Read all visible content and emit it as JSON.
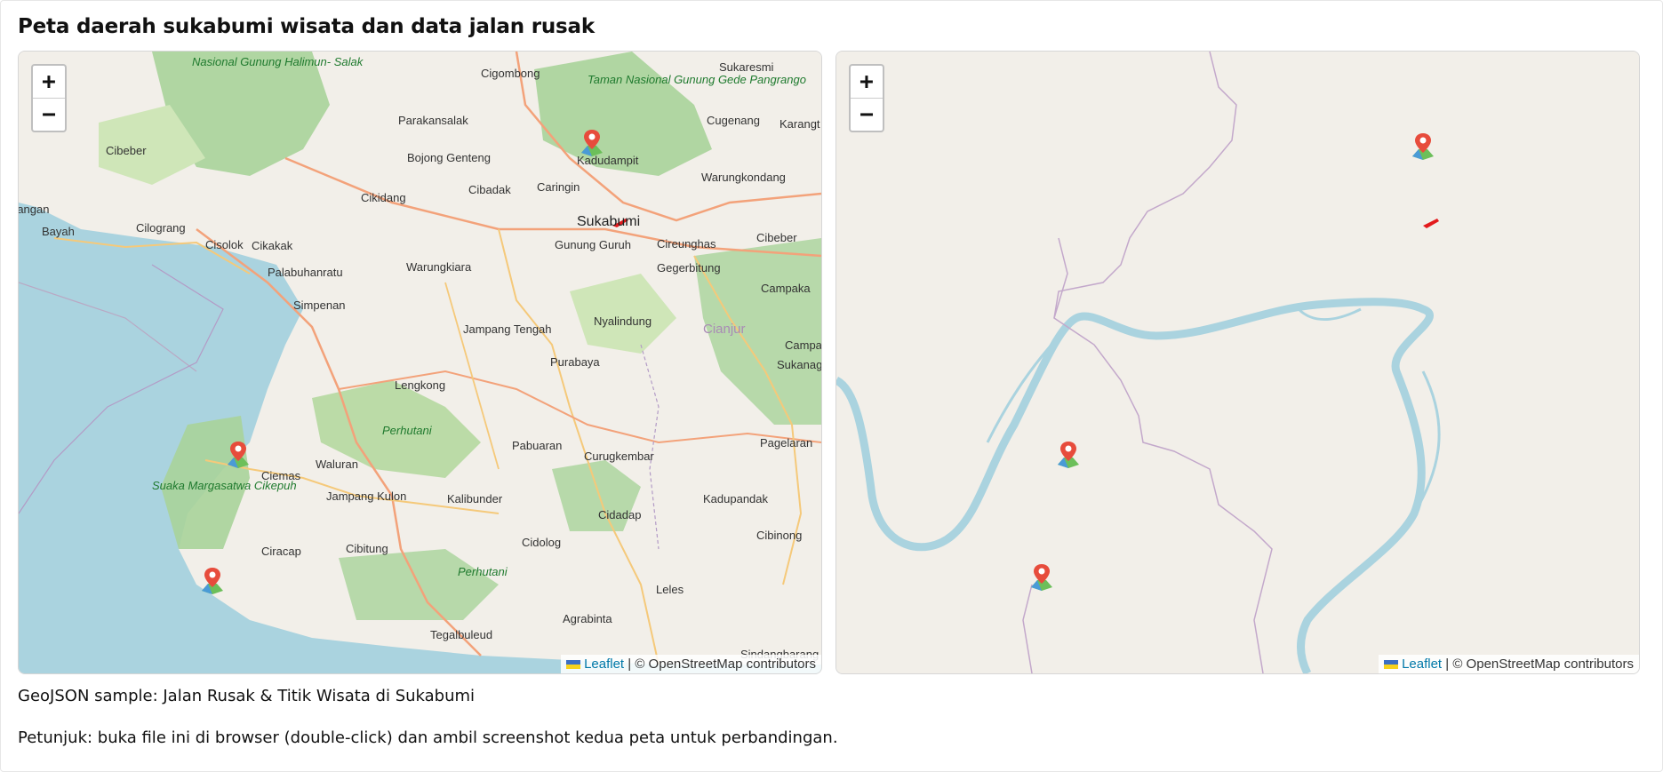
{
  "page": {
    "title": "Peta daerah sukabumi wisata dan data jalan rusak",
    "caption": "GeoJSON sample: Jalan Rusak & Titik Wisata di Sukabumi",
    "instructions": "Petunjuk: buka file ini di browser (double-click) dan ambil screenshot kedua peta untuk perbandingan."
  },
  "maps": [
    {
      "zoom_in": "+",
      "zoom_out": "−",
      "attribution": {
        "leaflet": "Leaflet",
        "rest": " | © OpenStreetMap contributors"
      },
      "labels": {
        "nasional_gunung": "Nasional Gunung Halimun- Salak",
        "cigombong": "Cigombong",
        "sukaresmi": "Sukaresmi",
        "taman_nasional": "Taman Nasional Gunung Gede Pangrango",
        "parakansalak": "Parakansalak",
        "cugenang": "Cugenang",
        "karangt": "Karangt",
        "cibeber_w": "Cibeber",
        "bojong_genteng": "Bojong Genteng",
        "kadudampit": "Kadudampit",
        "warungkondang": "Warungkondang",
        "cibadak": "Cibadak",
        "caringin": "Caringin",
        "cikidang": "Cikidang",
        "rangan": "rangan",
        "bayah": "Bayah",
        "cilograng": "Cilograng",
        "sukabumi": "Sukabumi",
        "gunung_guruh": "Gunung Guruh",
        "cireunghas": "Cireunghas",
        "cibeber_e": "Cibeber",
        "cisolok": "Cisolok",
        "cikakak": "Cikakak",
        "palabuhanratu": "Palabuhanratu",
        "warungkiara": "Warungkiara",
        "gegerbitung": "Gegerbitung",
        "campaka": "Campaka",
        "simpenan": "Simpenan",
        "nyalindung": "Nyalindung",
        "jampang_tengah": "Jampang Tengah",
        "cianjur": "Cianjur",
        "campakam": "Campakam",
        "sukanagara": "Sukanagara",
        "purabaya": "Purabaya",
        "lengkong": "Lengkong",
        "perhutani_1": "Perhutani",
        "pagelaran": "Pagelaran",
        "pabuaran": "Pabuaran",
        "curugkembar": "Curugkembar",
        "ciemas": "Ciemas",
        "waluran": "Waluran",
        "suaka": "Suaka Margasatwa Cikepuh",
        "jampang_kulon": "Jampang Kulon",
        "kalibunder": "Kalibunder",
        "kadupandak": "Kadupandak",
        "cidadap": "Cidadap",
        "cibinong": "Cibinong",
        "ciracap": "Ciracap",
        "cibitung": "Cibitung",
        "cidolog": "Cidolog",
        "perhutani_2": "Perhutani",
        "leles": "Leles",
        "agrabinta": "Agrabinta",
        "tegalbuleud": "Tegalbuleud",
        "sindangbarang": "Sindangbarang"
      }
    },
    {
      "zoom_in": "+",
      "zoom_out": "−",
      "attribution": {
        "leaflet": "Leaflet",
        "rest": " | © OpenStreetMap contributors"
      }
    }
  ],
  "icons": {
    "marker": "map-pin-icon",
    "zoom_in": "plus-icon",
    "zoom_out": "minus-icon"
  },
  "colors": {
    "water": "#aad3df",
    "land": "#f2efe9",
    "forest": "#a8d39a",
    "road_major": "#f3a27a",
    "road_minor": "#f5c97a",
    "damaged_road": "#e31a1c",
    "marker_red": "#e74c3c",
    "leaflet_link": "#0078a8"
  }
}
